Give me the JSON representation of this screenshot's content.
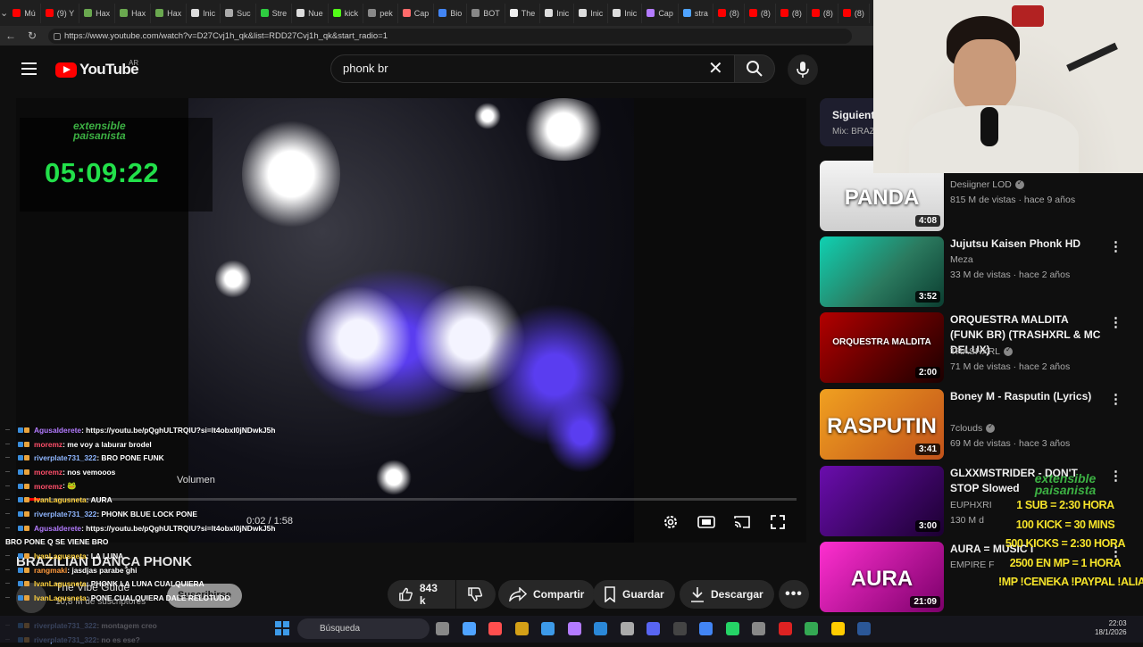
{
  "browser": {
    "tabs": [
      {
        "label": "Mú",
        "color": "#ff0000"
      },
      {
        "label": "(9) Y",
        "color": "#ff0000"
      },
      {
        "label": "Hax",
        "color": "#6aa84f"
      },
      {
        "label": "Hax",
        "color": "#6aa84f"
      },
      {
        "label": "Hax",
        "color": "#6aa84f"
      },
      {
        "label": "Inic",
        "color": "#dddddd"
      },
      {
        "label": "Suc",
        "color": "#aaaaaa"
      },
      {
        "label": "Stre",
        "color": "#2ecc40"
      },
      {
        "label": "Nue",
        "color": "#dddddd"
      },
      {
        "label": "kick",
        "color": "#53fc18"
      },
      {
        "label": "pek",
        "color": "#888888"
      },
      {
        "label": "Cap",
        "color": "#ff6b6b"
      },
      {
        "label": "Bio",
        "color": "#4285f4"
      },
      {
        "label": "BOT",
        "color": "#888888"
      },
      {
        "label": "The",
        "color": "#eeeeee"
      },
      {
        "label": "Inic",
        "color": "#dddddd"
      },
      {
        "label": "Inic",
        "color": "#dddddd"
      },
      {
        "label": "Inic",
        "color": "#dddddd"
      },
      {
        "label": "Cap",
        "color": "#b37bff"
      },
      {
        "label": "stra",
        "color": "#4fa3ff"
      },
      {
        "label": "(8)",
        "color": "#ff0000"
      },
      {
        "label": "(8)",
        "color": "#ff0000"
      },
      {
        "label": "(8)",
        "color": "#ff0000"
      },
      {
        "label": "(8)",
        "color": "#ff0000"
      },
      {
        "label": "(8)",
        "color": "#ff0000"
      },
      {
        "label": "(8)",
        "color": "#ff0000"
      }
    ],
    "url": "https://www.youtube.com/watch?v=D27Cvj1h_qk&list=RDD27Cvj1h_qk&start_radio=1"
  },
  "header": {
    "logo_text": "YouTube",
    "country": "AR",
    "search_value": "phonk br"
  },
  "player": {
    "overlay_logo_line1": "extensible",
    "overlay_logo_line2": "paisanista",
    "timer": "05:09:22",
    "volume_tooltip": "Volumen",
    "time_display": "0:02 / 1:58",
    "progress": 0.017
  },
  "video": {
    "title": "BRAZILIAN DANÇA PHONK",
    "channel": "The Vibe Guide",
    "subscribers": "10,8 M de suscriptores",
    "subscribe_label": "Suscribirse",
    "like_count": "843 k",
    "share_label": "Compartir",
    "save_label": "Guardar",
    "download_label": "Descargar"
  },
  "chat": [
    {
      "user": "Agusalderete",
      "msg": ": https://youtu.be/pQghULTRQIU?si=It4obxI0jNDwkJ5h",
      "color": "#b37bff"
    },
    {
      "user": "moremz",
      "msg": ": me voy a laburar brodel",
      "color": "#ff4f6a"
    },
    {
      "user": "riverplate731_322",
      "msg": ": BRO PONE FUNK",
      "color": "#8fb6ff"
    },
    {
      "user": "moremz",
      "msg": ": nos vemooos",
      "color": "#ff4f6a"
    },
    {
      "user": "moremz",
      "msg": ": 🐸",
      "color": "#ff4f6a"
    },
    {
      "user": "IvanLagusneta",
      "msg": ": AURA",
      "color": "#ffd23f"
    },
    {
      "user": "riverplate731_322",
      "msg": ": PHONK BLUE LOCK PONE",
      "color": "#8fb6ff"
    },
    {
      "user": "Agusalderete",
      "msg": ": https://youtu.be/pQghULTRQIU?si=It4obxI0jNDwkJ5h",
      "color": "#b37bff"
    },
    {
      "user": "",
      "msg": "BRO PONE Q SE VIENE BRO",
      "color": "#ffffff"
    },
    {
      "user": "IvanLagusneta",
      "msg": ": LA LUNA",
      "color": "#ffd23f"
    },
    {
      "user": "rangmaki",
      "msg": ": jasdjas parabe ghi",
      "color": "#ff9a3c"
    },
    {
      "user": "IvanLagusneta",
      "msg": ": PHONK LA LUNA CUALQUIERA",
      "color": "#ffd23f"
    },
    {
      "user": "IvanLagusneta",
      "msg": ": PONE CUALQUIERA DALE RELOTUDO",
      "color": "#ffd23f"
    },
    {
      "user": "",
      "msg": "",
      "color": "#ffffff"
    },
    {
      "user": "riverplate731_322",
      "msg": ": montagem creo",
      "color": "#8fb6ff"
    },
    {
      "user": "riverplate731_322",
      "msg": ": no es ese?",
      "color": "#8fb6ff"
    }
  ],
  "sidebar": {
    "next_label": "Siguiente",
    "next_sub": "Mix: BRAZ",
    "recs": [
      {
        "title": "",
        "channel": "Desiigner LOD",
        "meta": "815 M de vistas · hace 9 años",
        "duration": "4:08",
        "thumb_text": "PANDA",
        "thumb_color": "#ffffff",
        "thumb_bg": "linear-gradient(180deg,#f4f4f4,#cfcfcf)",
        "verified": true
      },
      {
        "title": "Jujutsu Kaisen Phonk HD",
        "channel": "Meza",
        "meta": "33 M de vistas · hace 2 años",
        "duration": "3:52",
        "thumb_text": "",
        "thumb_color": "#ffffff",
        "thumb_bg": "linear-gradient(135deg,#0fd1b2,#2b7a5f 55%,#0b3d30)",
        "verified": false
      },
      {
        "title": "ORQUESTRA MALDITA (FUNK BR) (TRASHXRL & MC DELUX)",
        "channel": "TRASHXRL",
        "meta": "71 M de vistas · hace 2 años",
        "duration": "2:00",
        "thumb_text": "ORQUESTRA MALDITA",
        "thumb_color": "#ffffff",
        "thumb_bg": "linear-gradient(135deg,#b30000,#1a0000)",
        "verified": true
      },
      {
        "title": "Boney M - Rasputin (Lyrics)",
        "channel": "7clouds",
        "meta": "69 M de vistas · hace 3 años",
        "duration": "3:41",
        "thumb_text": "RASPUTIN",
        "thumb_color": "#ffffff",
        "thumb_bg": "linear-gradient(135deg,#f0a020,#c2521a)",
        "verified": true
      },
      {
        "title": "GLXXMSTRIDER - DON'T STOP Slowed",
        "channel": "EUPHXRI",
        "meta": "130 M d",
        "duration": "3:00",
        "thumb_text": "",
        "thumb_color": "#ffffff",
        "thumb_bg": "linear-gradient(135deg,#6a0dad,#1b0030)",
        "verified": false
      },
      {
        "title": "AURA = MUSIC I",
        "channel": "EMPIRE F",
        "meta": "",
        "duration": "21:09",
        "thumb_text": "AURA",
        "thumb_color": "#ffffff",
        "thumb_bg": "linear-gradient(135deg,#ff2fd0,#7b006a)",
        "verified": false
      }
    ]
  },
  "info_overlay": {
    "logo_line1": "extensible",
    "logo_line2": "paisanista",
    "lines": [
      "1 SUB = 2:30 HORA",
      "100 KICK = 30 MINS",
      "500 KICKS = 2:30 HORA",
      "2500 EN MP = 1 HORA",
      "!MP !CENEKA !PAYPAL !ALIAS"
    ]
  },
  "taskbar": {
    "search_label": "Búsqueda",
    "time": "22:03",
    "date": "18/1/2026",
    "icon_colors": [
      "#888888",
      "#4fa3ff",
      "#ff4f4f",
      "#d4a017",
      "#3d9ae8",
      "#b37bff",
      "#2b88d8",
      "#aaaaaa",
      "#5865f2",
      "#444444",
      "#4285f4",
      "#25d366",
      "#888888",
      "#dd2222",
      "#34a853",
      "#ffcc00",
      "#2b5797"
    ]
  },
  "colors": {
    "yt_red": "#ff0000",
    "timer_green": "#22e04a",
    "info_yellow": "#f5e32a"
  }
}
